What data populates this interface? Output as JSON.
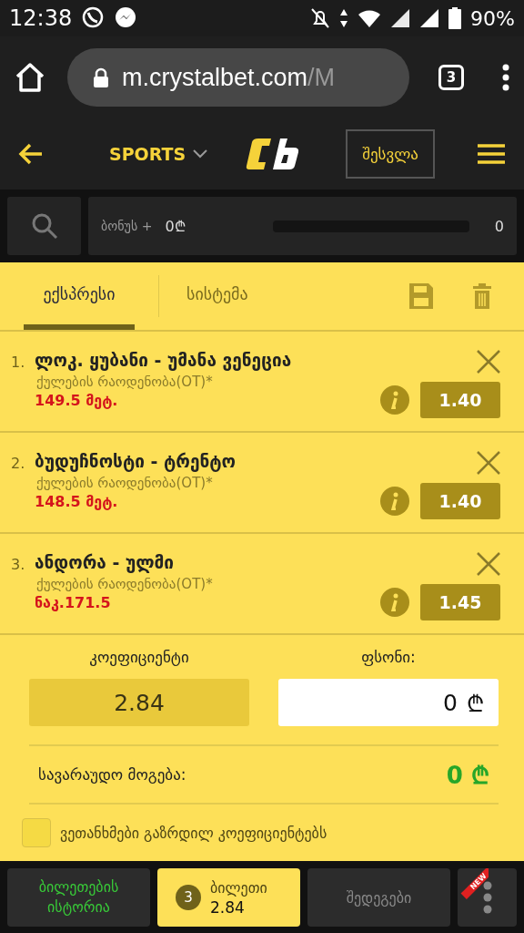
{
  "status_bar": {
    "time": "12:38",
    "battery": "90%"
  },
  "browser": {
    "url_host": "m.crystalbet.com",
    "url_path": "/M",
    "tab_count": "3"
  },
  "header": {
    "section": "SPORTS",
    "login": "შესვლა"
  },
  "bonus": {
    "label": "ბონუს +",
    "amount": "0₾",
    "level": 0,
    "count": "0"
  },
  "tabs": [
    {
      "label": "ექსპრესი",
      "selected": true
    },
    {
      "label": "სისტემა",
      "selected": false
    }
  ],
  "bets": [
    {
      "number": "1.",
      "match": "ლოკ. ყუბანი - უმანა ვენეცია",
      "market": "ქულების რაოდენობა(OT)*",
      "pick": "149.5 მეტ.",
      "odds": "1.40"
    },
    {
      "number": "2.",
      "match": "ბუდუჩნოსტი - ტრენტო",
      "market": "ქულების რაოდენობა(OT)*",
      "pick": "148.5 მეტ.",
      "odds": "1.40"
    },
    {
      "number": "3.",
      "match": "ანდორა - ულმი",
      "market": "ქულების რაოდენობა(OT)*",
      "pick": "ნაკ.171.5",
      "odds": "1.45"
    }
  ],
  "summary": {
    "coef_label": "კოეფიციენტი",
    "coef_value": "2.84",
    "stake_label": "ფსონი:",
    "stake_value": "0",
    "stake_currency": "₾",
    "win_label": "სავარაუდო მოგება:",
    "win_value": "0 ₾"
  },
  "agree": {
    "label": "ვეთანხმები გაზრდილ კოეფიციენტებს",
    "checked": false
  },
  "bottom_nav": [
    {
      "kind": "history",
      "label": "ბილეთების ისტორია",
      "selected": false
    },
    {
      "kind": "ticket",
      "count": "3",
      "label": "ბილეთი",
      "value": "2.84",
      "selected": true
    },
    {
      "kind": "results",
      "label": "შედეგები",
      "selected": false
    },
    {
      "kind": "more",
      "badge": "NEW",
      "selected": false
    }
  ]
}
